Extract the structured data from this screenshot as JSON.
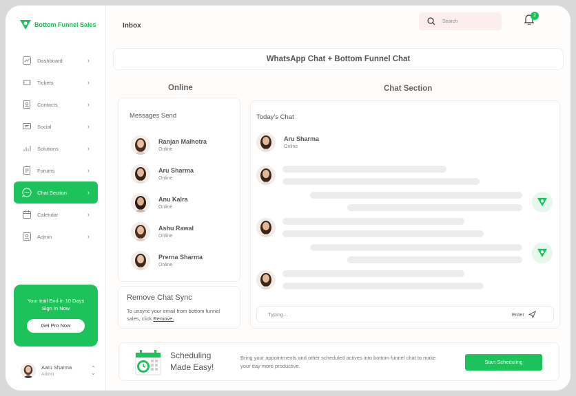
{
  "app": {
    "brand": "Bottom Funnel Sales",
    "page_title": "Inbox"
  },
  "search": {
    "placeholder": "Search"
  },
  "notifications": {
    "count": "2"
  },
  "sidebar": {
    "items": [
      {
        "label": "Dashboard",
        "icon": "chart-icon"
      },
      {
        "label": "Tickets",
        "icon": "ticket-icon"
      },
      {
        "label": "Contacts",
        "icon": "contacts-icon"
      },
      {
        "label": "Social",
        "icon": "social-icon"
      },
      {
        "label": "Solutions",
        "icon": "solutions-icon"
      },
      {
        "label": "Forums",
        "icon": "forums-icon"
      },
      {
        "label": "Chat Section",
        "icon": "chat-icon",
        "active": true
      },
      {
        "label": "Calendar",
        "icon": "calendar-icon"
      },
      {
        "label": "Admin",
        "icon": "admin-icon"
      }
    ],
    "promo": {
      "line1": "Your trail End in 10 Days",
      "line2": "Sign In Now",
      "button": "Get Pro Now"
    },
    "user": {
      "name": "Aaru Sharma",
      "role": "Admin"
    }
  },
  "banner": {
    "title": "WhatsApp Chat + Bottom Funnel Chat"
  },
  "online": {
    "title": "Online",
    "card_title": "Messages Send",
    "contacts": [
      {
        "name": "Ranjan Malhotra",
        "status": "Online"
      },
      {
        "name": "Aru Sharma",
        "status": "Online"
      },
      {
        "name": "Anu Kalra",
        "status": "Online"
      },
      {
        "name": "Ashu Rawal",
        "status": "Online"
      },
      {
        "name": "Prerna Sharma",
        "status": "Online"
      }
    ]
  },
  "remove_sync": {
    "title": "Remove Chat Sync",
    "text": "To unsync your email from bottom funnel  sales, click",
    "link": "Remove."
  },
  "chat": {
    "title": "Chat Section",
    "today": "Today’s Chat",
    "contact": {
      "name": "Aru Sharma",
      "status": "Online"
    },
    "input_placeholder": "Typing...",
    "enter_label": "Enter"
  },
  "scheduling": {
    "heading_line1": "Scheduling",
    "heading_line2": "Made Easy!",
    "description": "Bring your appointments and other scheduled actives into bottom funnel chat to make your day more productive.",
    "button": "Start Scheduling"
  },
  "colors": {
    "accent": "#1ec25b",
    "search_bg": "#fdeeee"
  }
}
